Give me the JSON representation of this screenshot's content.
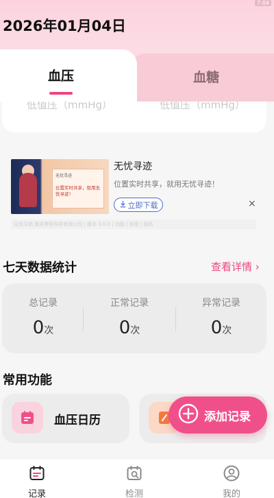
{
  "status_corner": "7:04",
  "date_title": "2026年01月04日",
  "tabs": [
    {
      "label": "血压",
      "active": true
    },
    {
      "label": "血糖",
      "active": false
    }
  ],
  "cut_card": {
    "left_text": "低值压（mmHg）",
    "right_text": "低值压（mmHg）"
  },
  "ad": {
    "thumb_text_1": "无忧寻迹",
    "thumb_text_2": "位置实时共享，就用无忧寻迹！",
    "title": "无忧寻迹",
    "description": "位置实时共享，就用无忧寻迹！",
    "button_label": "立即下载",
    "close_symbol": "×",
    "footer": "无忧寻迹 重庆零条科技有限公司 | 版本 3.0.0 | 功能 | 权限 | 隐私"
  },
  "stats_section": {
    "title": "七天数据统计",
    "details_link": "查看详情 ›",
    "items": [
      {
        "label": "总记录",
        "value": "0",
        "unit": "次"
      },
      {
        "label": "正常记录",
        "value": "0",
        "unit": "次"
      },
      {
        "label": "异常记录",
        "value": "0",
        "unit": "次"
      }
    ]
  },
  "functions_section": {
    "title": "常用功能",
    "items": [
      {
        "label": "血压日历",
        "icon": "calendar-icon"
      },
      {
        "label": "",
        "icon": "notebook-icon"
      }
    ]
  },
  "fab": {
    "label": "添加记录",
    "icon": "plus-circle-icon"
  },
  "bottom_nav": [
    {
      "label": "记录",
      "icon": "calendar-icon",
      "active": true
    },
    {
      "label": "检测",
      "icon": "search-calendar-icon",
      "active": false
    },
    {
      "label": "我的",
      "icon": "user-icon",
      "active": false
    }
  ],
  "colors": {
    "accent": "#f0467d",
    "header_pink": "#fdd3de",
    "inactive_tab": "#f8cbd7"
  }
}
